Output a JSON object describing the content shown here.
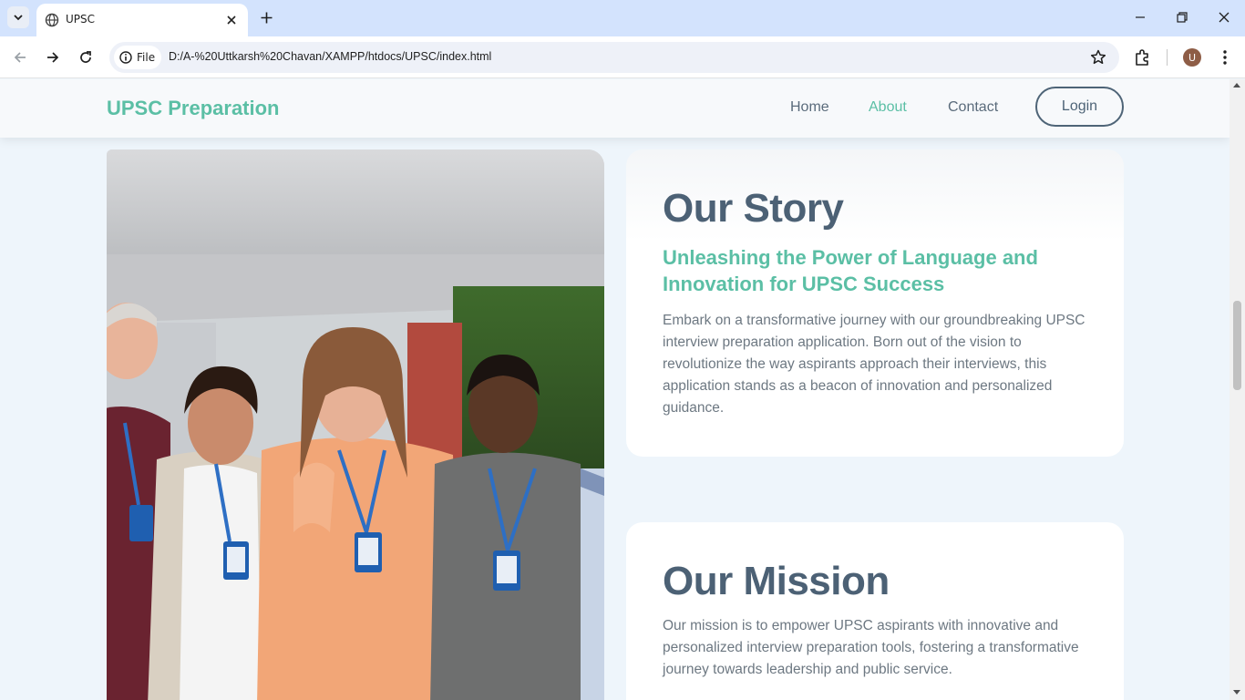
{
  "browser": {
    "tab_title": "UPSC",
    "site_chip_label": "File",
    "url": "D:/A-%20Uttkarsh%20Chavan/XAMPP/htdocs/UPSC/index.html",
    "profile_initial": "U"
  },
  "header": {
    "brand": "UPSC Preparation",
    "nav": [
      {
        "label": "Home"
      },
      {
        "label": "About"
      },
      {
        "label": "Contact"
      }
    ],
    "active_nav": "About",
    "login_label": "Login"
  },
  "story": {
    "title": "Our Story",
    "subtitle": "Unleashing the Power of Language and Innovation for UPSC Success",
    "body": "Embark on a transformative journey with our groundbreaking UPSC interview preparation application. Born out of the vision to revolutionize the way aspirants approach their interviews, this application stands as a beacon of innovation and personalized guidance."
  },
  "mission": {
    "title": "Our Mission",
    "body": "Our mission is to empower UPSC aspirants with innovative and personalized interview preparation tools, fostering a transformative journey towards leadership and public service."
  },
  "colors": {
    "accent": "#5bbfa5",
    "heading": "#4c6175",
    "page_bg": "#eef5fb",
    "chrome_tabstrip": "#d3e3fd"
  },
  "icons": [
    "tab-search-icon",
    "globe-icon",
    "close-icon",
    "plus-icon",
    "minimize-icon",
    "restore-icon",
    "back-arrow-icon",
    "forward-arrow-icon",
    "reload-icon",
    "info-icon",
    "star-icon",
    "extensions-icon",
    "more-vert-icon"
  ]
}
